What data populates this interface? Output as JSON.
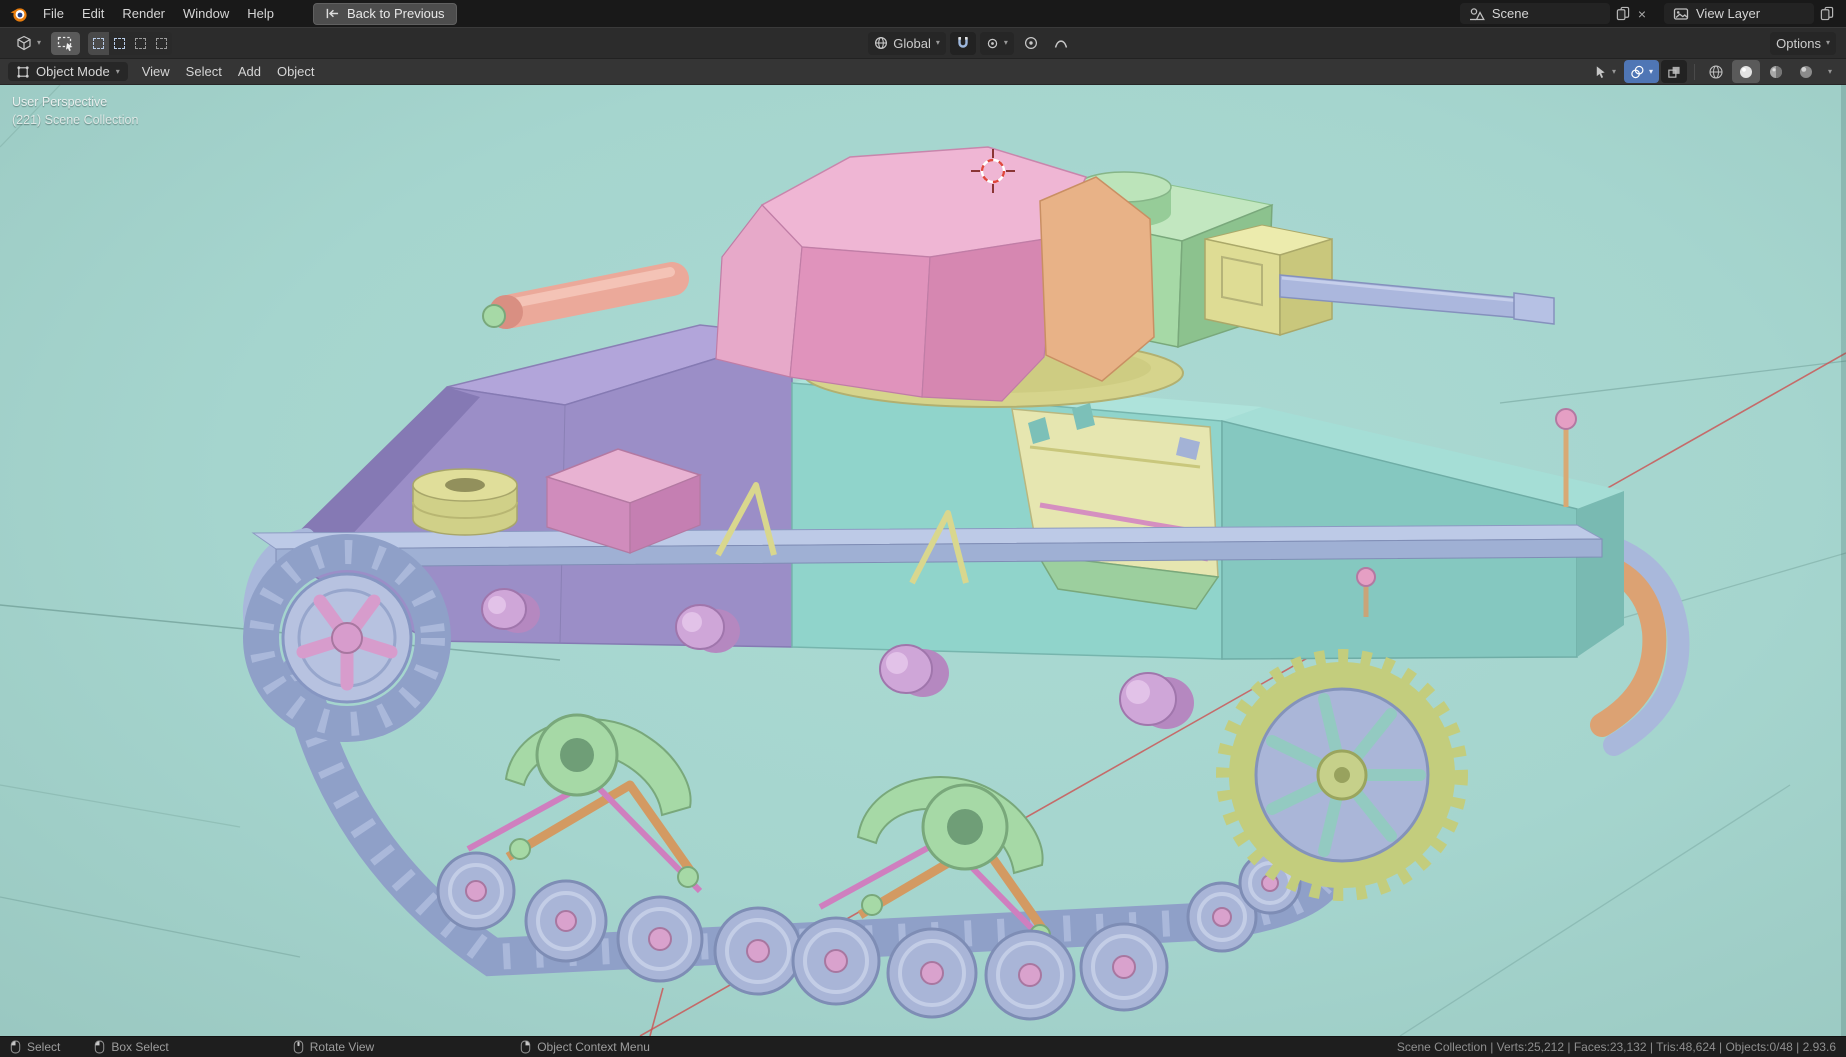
{
  "topbar": {
    "menus": [
      {
        "label": "File"
      },
      {
        "label": "Edit"
      },
      {
        "label": "Render"
      },
      {
        "label": "Window"
      },
      {
        "label": "Help"
      }
    ],
    "back_button_label": "Back to Previous",
    "scene_selector": {
      "value": "Scene"
    },
    "view_layer_selector": {
      "value": "View Layer"
    }
  },
  "tool_settings": {
    "orientation": {
      "value": "Global"
    },
    "options_label": "Options"
  },
  "viewport_header": {
    "mode_selector": {
      "value": "Object Mode"
    },
    "menus": [
      {
        "label": "View"
      },
      {
        "label": "Select"
      },
      {
        "label": "Add"
      },
      {
        "label": "Object"
      }
    ]
  },
  "viewport": {
    "overlay": {
      "line1": "User Perspective",
      "line2": "(221) Scene Collection"
    }
  },
  "statusbar": {
    "hints": [
      {
        "label": "Select"
      },
      {
        "label": "Box Select"
      },
      {
        "label": "Rotate View"
      },
      {
        "label": "Object Context Menu"
      }
    ],
    "stats": "Scene Collection | Verts:25,212 | Faces:23,132 | Tris:48,624 | Objects:0/48 | 2.93.6"
  },
  "icons": {
    "chevron": "▾",
    "close": "×"
  },
  "colors": {
    "viewport_background": "#a6d5ce",
    "blender_orange": "#e87d0d",
    "selection_blue": "#4f76b5"
  }
}
